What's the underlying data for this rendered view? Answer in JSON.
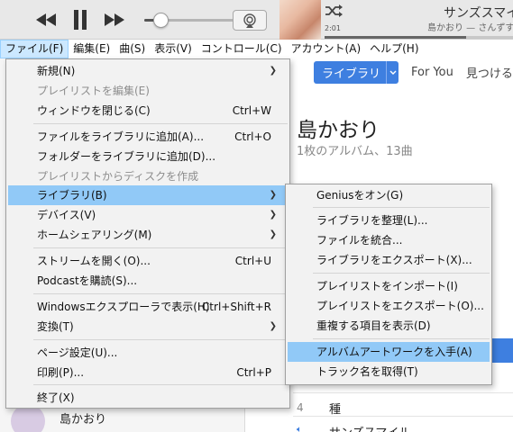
{
  "player": {
    "time_elapsed": "2:01",
    "now_playing_title": "サンズスマイル",
    "now_playing_artist": "島かおり — さんずする",
    "volume_percent": 17,
    "progress_percent": 75
  },
  "menubar": [
    {
      "label": "ファイル(F)",
      "active": true
    },
    {
      "label": "編集(E)"
    },
    {
      "label": "曲(S)"
    },
    {
      "label": "表示(V)"
    },
    {
      "label": "コントロール(C)"
    },
    {
      "label": "アカウント(A)"
    },
    {
      "label": "ヘルプ(H)"
    }
  ],
  "nav": {
    "library": "ライブラリ",
    "for_you": "For You",
    "browse": "見つける"
  },
  "content": {
    "artist": "島かおり",
    "subtitle": "1枚のアルバム、13曲",
    "track_number": "4",
    "track_name": "種",
    "next_track": "サンズスマイル",
    "sidebar_artist": "島かおり"
  },
  "file_menu": {
    "new": "新規(N)",
    "edit_playlist": "プレイリストを編集(E)",
    "close_window": "ウィンドウを閉じる(C)",
    "close_window_sc": "Ctrl+W",
    "add_file": "ファイルをライブラリに追加(A)...",
    "add_file_sc": "Ctrl+O",
    "add_folder": "フォルダーをライブラリに追加(D)...",
    "burn_playlist": "プレイリストからディスクを作成",
    "library": "ライブラリ(B)",
    "devices": "デバイス(V)",
    "home_sharing": "ホームシェアリング(M)",
    "open_stream": "ストリームを開く(O)...",
    "open_stream_sc": "Ctrl+U",
    "podcast": "Podcastを購読(S)...",
    "show_in_explorer": "Windowsエクスプローラで表示(H)",
    "show_in_explorer_sc": "Ctrl+Shift+R",
    "convert": "変換(T)",
    "page_setup": "ページ設定(U)...",
    "print": "印刷(P)...",
    "print_sc": "Ctrl+P",
    "exit": "終了(X)"
  },
  "library_menu": {
    "genius_on": "Geniusをオン(G)",
    "organize": "ライブラリを整理(L)...",
    "consolidate": "ファイルを統合...",
    "export_library": "ライブラリをエクスポート(X)...",
    "import_playlist": "プレイリストをインポート(I)",
    "export_playlist": "プレイリストをエクスポート(O)...",
    "show_duplicates": "重複する項目を表示(D)",
    "get_artwork": "アルバムアートワークを入手(A)",
    "get_track_names": "トラック名を取得(T)"
  },
  "colors": {
    "accent": "#3e7fe0",
    "menu_highlight": "#91c9f7",
    "menubar_active": "#cce8ff"
  }
}
